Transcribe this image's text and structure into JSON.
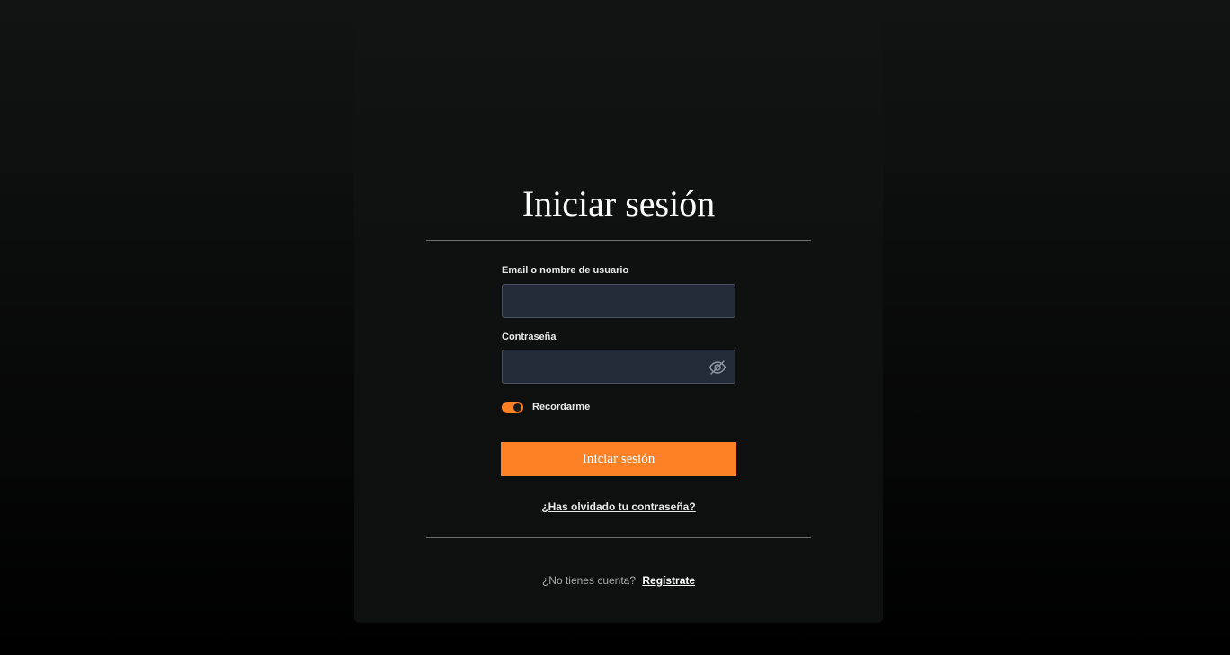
{
  "login": {
    "title": "Iniciar sesión",
    "email_label": "Email o nombre de usuario",
    "email_value": "",
    "password_label": "Contraseña",
    "password_value": "",
    "remember_label": "Recordarme",
    "remember_checked": true,
    "submit_label": "Iniciar sesión",
    "forgot_label": "¿Has olvidado tu contraseña?",
    "no_account_text": "¿No tienes cuenta?",
    "signup_label": "Regístrate"
  },
  "icons": {
    "password_toggle": "eye-off-icon"
  },
  "colors": {
    "accent": "#ff8126",
    "input_background": "#232b39",
    "card_background": "#0f1111"
  }
}
